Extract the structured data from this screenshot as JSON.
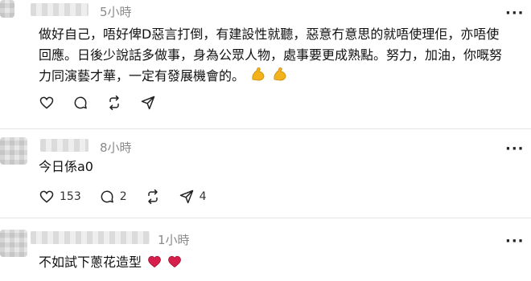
{
  "posts": [
    {
      "time": "5小時",
      "lines": [
        "做好自己，唔好俾D惡言打倒，有建設性就聽，惡意冇意思的就唔使理佢，亦唔使",
        "回應。日後少說話多做事，身為公眾人物，處事要更成熟點。努力，加油，你嘅努",
        "力同演藝才華，一定有發展機會的。"
      ],
      "emoji": "flexed-biceps-icon x2",
      "counts": {
        "like": "",
        "reply": "",
        "repost": "",
        "share": ""
      }
    },
    {
      "time": "8小時",
      "lines": [
        "今日係a0"
      ],
      "counts": {
        "like": "153",
        "reply": "2",
        "repost": "",
        "share": "4"
      }
    },
    {
      "time": "1小時",
      "lines": [
        "不如試下蔥花造型"
      ],
      "emoji": "heart-icon x2"
    }
  ],
  "more_label": "···",
  "colors": {
    "text": "#111111",
    "muted": "#8a8a8a",
    "divider": "#e3e3e3",
    "heart": "#d6204b",
    "bicep": "#f2b21b"
  }
}
